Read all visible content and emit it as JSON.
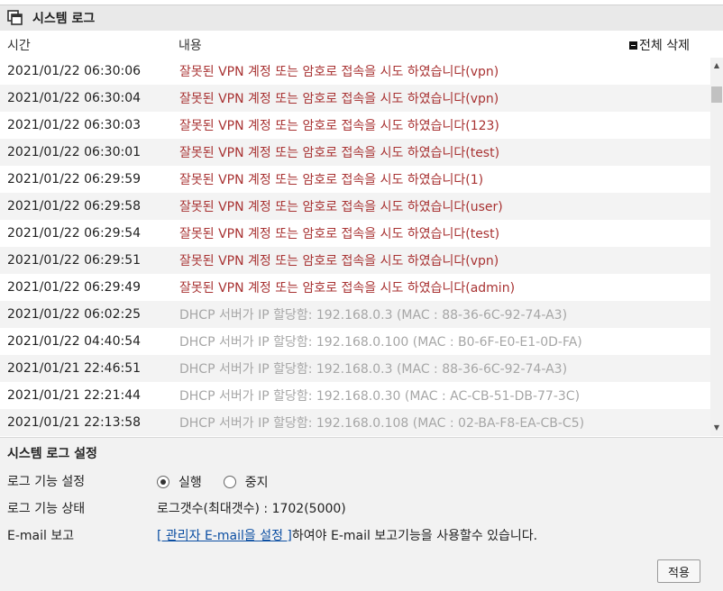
{
  "panel": {
    "title": "시스템 로그",
    "icon": "window-stack-icon"
  },
  "columns": {
    "time": "시간",
    "message": "내용",
    "delete_all": "전체 삭제"
  },
  "logs": [
    {
      "time": "2021/01/22 06:30:06",
      "message": "잘못된 VPN 계정 또는 암호로 접속을 시도 하였습니다(vpn)",
      "type": "warn"
    },
    {
      "time": "2021/01/22 06:30:04",
      "message": "잘못된 VPN 계정 또는 암호로 접속을 시도 하였습니다(vpn)",
      "type": "warn"
    },
    {
      "time": "2021/01/22 06:30:03",
      "message": "잘못된 VPN 계정 또는 암호로 접속을 시도 하였습니다(123)",
      "type": "warn"
    },
    {
      "time": "2021/01/22 06:30:01",
      "message": "잘못된 VPN 계정 또는 암호로 접속을 시도 하였습니다(test)",
      "type": "warn"
    },
    {
      "time": "2021/01/22 06:29:59",
      "message": "잘못된 VPN 계정 또는 암호로 접속을 시도 하였습니다(1)",
      "type": "warn"
    },
    {
      "time": "2021/01/22 06:29:58",
      "message": "잘못된 VPN 계정 또는 암호로 접속을 시도 하였습니다(user)",
      "type": "warn"
    },
    {
      "time": "2021/01/22 06:29:54",
      "message": "잘못된 VPN 계정 또는 암호로 접속을 시도 하였습니다(test)",
      "type": "warn"
    },
    {
      "time": "2021/01/22 06:29:51",
      "message": "잘못된 VPN 계정 또는 암호로 접속을 시도 하였습니다(vpn)",
      "type": "warn"
    },
    {
      "time": "2021/01/22 06:29:49",
      "message": "잘못된 VPN 계정 또는 암호로 접속을 시도 하였습니다(admin)",
      "type": "warn"
    },
    {
      "time": "2021/01/22 06:02:25",
      "message": "DHCP 서버가 IP 할당함: 192.168.0.3 (MAC : 88-36-6C-92-74-A3)",
      "type": "info"
    },
    {
      "time": "2021/01/22 04:40:54",
      "message": "DHCP 서버가 IP 할당함: 192.168.0.100 (MAC : B0-6F-E0-E1-0D-FA)",
      "type": "info"
    },
    {
      "time": "2021/01/21 22:46:51",
      "message": "DHCP 서버가 IP 할당함: 192.168.0.3 (MAC : 88-36-6C-92-74-A3)",
      "type": "info"
    },
    {
      "time": "2021/01/21 22:21:44",
      "message": "DHCP 서버가 IP 할당함: 192.168.0.30 (MAC : AC-CB-51-DB-77-3C)",
      "type": "info"
    },
    {
      "time": "2021/01/21 22:13:58",
      "message": "DHCP 서버가 IP 할당함: 192.168.0.108 (MAC : 02-BA-F8-EA-CB-C5)",
      "type": "info"
    }
  ],
  "colors": {
    "warn": "#a83232",
    "info": "#a6a6a6",
    "link": "#0b4ea2"
  },
  "settings": {
    "title": "시스템 로그 설정",
    "log_function_label": "로그 기능 설정",
    "option_run": "실행",
    "option_stop": "중지",
    "selected": "실행",
    "log_status_label": "로그 기능 상태",
    "log_status_value": "로그갯수(최대갯수) : 1702(5000)",
    "email_label": "E-mail 보고",
    "email_link": "[ 관리자 E-mail을 설정 ]",
    "email_text": "하여야 E-mail 보고기능을 사용할수 있습니다.",
    "apply_button": "적용"
  }
}
